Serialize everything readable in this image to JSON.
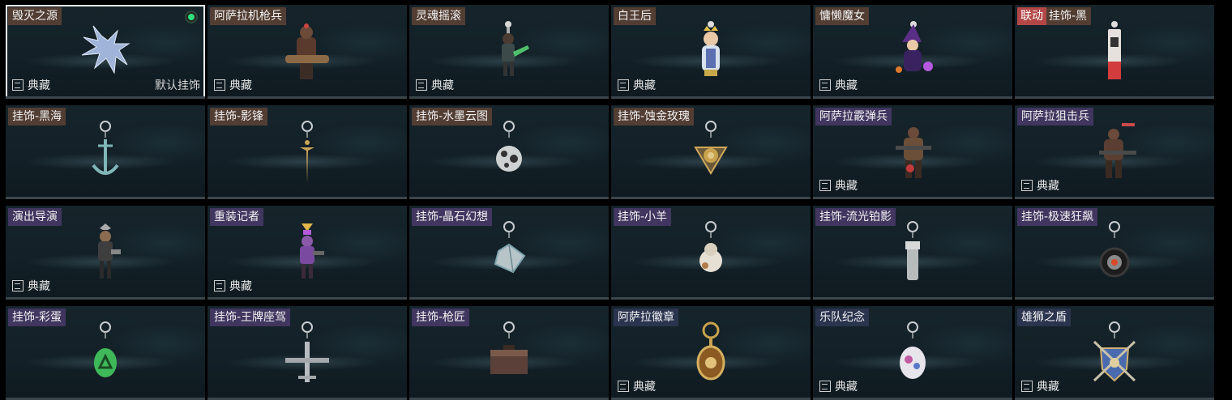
{
  "labels": {
    "collection": "典藏",
    "default_charm": "默认挂饰",
    "collab_badge": "联动"
  },
  "colors": {
    "tag_brown": "#584034",
    "tag_purple": "#423862",
    "tag_navy": "#2c3650",
    "collab_red": "#b34747",
    "equipped_green": "#2fe07a"
  },
  "items": [
    {
      "name": "毁灭之源",
      "tag_style": "brown",
      "collection": true,
      "selected": true,
      "equipped": true,
      "default": true,
      "icon": "dragon-charm-icon"
    },
    {
      "name": "阿萨拉机枪兵",
      "tag_style": "brown",
      "collection": true,
      "icon": "gunner-figure-icon"
    },
    {
      "name": "灵魂摇滚",
      "tag_style": "brown",
      "collection": true,
      "icon": "guitarist-figure-icon"
    },
    {
      "name": "白王后",
      "tag_style": "brown",
      "collection": true,
      "icon": "queen-figure-icon"
    },
    {
      "name": "慵懒魔女",
      "tag_style": "brown",
      "collection": true,
      "icon": "witch-figure-icon"
    },
    {
      "name": "挂饰-黑",
      "tag_style": "brown",
      "collab": true,
      "collection": false,
      "icon": "lighter-charm-icon"
    },
    {
      "name": "挂饰-黑海",
      "tag_style": "brown",
      "collection": false,
      "icon": "anchor-charm-icon"
    },
    {
      "name": "挂饰-影锋",
      "tag_style": "brown",
      "collection": false,
      "icon": "dagger-charm-icon"
    },
    {
      "name": "挂饰-水墨云图",
      "tag_style": "brown",
      "collection": false,
      "icon": "ball-charm-icon"
    },
    {
      "name": "挂饰-蚀金玫瑰",
      "tag_style": "brown",
      "collection": false,
      "icon": "rose-charm-icon"
    },
    {
      "name": "阿萨拉霰弹兵",
      "tag_style": "purple",
      "collection": true,
      "icon": "shotgunner-figure-icon"
    },
    {
      "name": "阿萨拉狙击兵",
      "tag_style": "purple",
      "collection": true,
      "icon": "sniper-figure-icon"
    },
    {
      "name": "演出导演",
      "tag_style": "purple",
      "collection": true,
      "icon": "director-figure-icon"
    },
    {
      "name": "重装记者",
      "tag_style": "purple",
      "collection": true,
      "icon": "reporter-figure-icon"
    },
    {
      "name": "挂饰-晶石幻想",
      "tag_style": "purple",
      "collection": false,
      "icon": "crystal-charm-icon"
    },
    {
      "name": "挂饰-小羊",
      "tag_style": "purple",
      "collection": false,
      "icon": "sheep-charm-icon"
    },
    {
      "name": "挂饰-流光铂影",
      "tag_style": "purple",
      "collection": false,
      "icon": "flashlight-charm-icon"
    },
    {
      "name": "挂饰-极速狂飙",
      "tag_style": "purple",
      "collection": false,
      "icon": "wheel-charm-icon"
    },
    {
      "name": "挂饰-彩蛋",
      "tag_style": "purple",
      "collection": false,
      "icon": "egg-charm-icon"
    },
    {
      "name": "挂饰-王牌座驾",
      "tag_style": "purple",
      "collection": false,
      "icon": "jet-charm-icon"
    },
    {
      "name": "挂饰-枪匠",
      "tag_style": "purple",
      "collection": false,
      "icon": "toolbox-charm-icon"
    },
    {
      "name": "阿萨拉徽章",
      "tag_style": "navy",
      "collection": true,
      "icon": "badge-charm-icon"
    },
    {
      "name": "乐队纪念",
      "tag_style": "navy",
      "collection": true,
      "icon": "medallion-charm-icon"
    },
    {
      "name": "雄狮之盾",
      "tag_style": "navy",
      "collection": true,
      "icon": "shield-charm-icon"
    }
  ]
}
